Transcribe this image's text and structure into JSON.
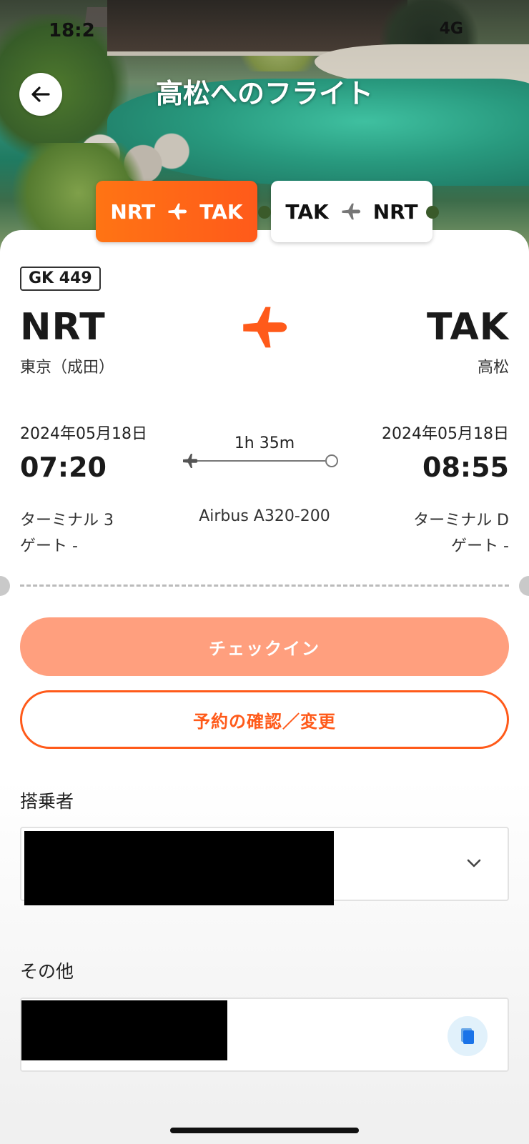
{
  "status_bar": {
    "time": "18:2",
    "signal": "4G"
  },
  "header": {
    "title": "高松へのフライト"
  },
  "legs": [
    {
      "from": "NRT",
      "to": "TAK"
    },
    {
      "from": "TAK",
      "to": "NRT"
    }
  ],
  "flight": {
    "number": "GK 449",
    "origin": {
      "code": "NRT",
      "city": "東京（成田）",
      "date": "2024年05月18日",
      "time": "07:20",
      "terminal": "ターミナル 3",
      "gate": "ゲート -"
    },
    "destination": {
      "code": "TAK",
      "city": "高松",
      "date": "2024年05月18日",
      "time": "08:55",
      "terminal": "ターミナル D",
      "gate": "ゲート -"
    },
    "duration": "1h 35m",
    "aircraft": "Airbus A320-200"
  },
  "actions": {
    "checkin": "チェックイン",
    "manage": "予約の確認／変更"
  },
  "passengers": {
    "label": "搭乗者"
  },
  "other": {
    "label": "その他"
  },
  "colors": {
    "accent": "#ff5a1a",
    "checkin_bg": "#ff9f7e"
  }
}
